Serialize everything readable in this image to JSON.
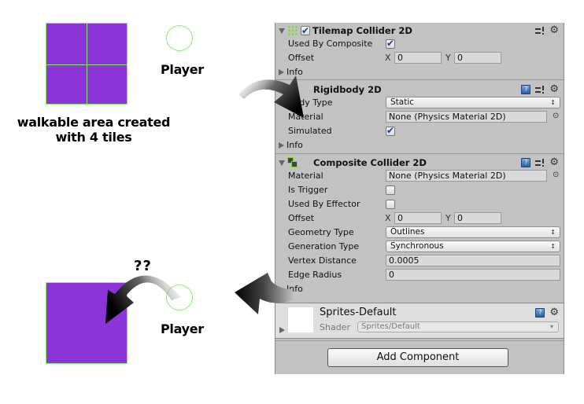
{
  "illustration": {
    "top_caption": "walkable area created with 4 tiles",
    "top_caption_line1": "walkable area created",
    "top_caption_line2": "with 4 tiles",
    "player_label_top": "Player",
    "player_label_bottom": "Player",
    "question_marks": "??",
    "tile_color": "#8b35d9",
    "outline_color": "#86f06a"
  },
  "inspector": {
    "tilemap_collider": {
      "title": "Tilemap Collider 2D",
      "enabled": true,
      "used_by_composite_label": "Used By Composite",
      "used_by_composite": true,
      "offset_label": "Offset",
      "offset_x_label": "X",
      "offset_x": "0",
      "offset_y_label": "Y",
      "offset_y": "0",
      "info_label": "Info"
    },
    "rigidbody": {
      "title": "Rigidbody 2D",
      "body_type_label": "Body Type",
      "body_type": "Static",
      "material_label": "Material",
      "material": "None (Physics Material 2D)",
      "simulated_label": "Simulated",
      "simulated": true,
      "info_label": "Info"
    },
    "composite_collider": {
      "title": "Composite Collider 2D",
      "material_label": "Material",
      "material": "None (Physics Material 2D)",
      "is_trigger_label": "Is Trigger",
      "is_trigger": false,
      "used_by_effector_label": "Used By Effector",
      "used_by_effector": false,
      "offset_label": "Offset",
      "offset_x_label": "X",
      "offset_x": "0",
      "offset_y_label": "Y",
      "offset_y": "0",
      "geometry_type_label": "Geometry Type",
      "geometry_type": "Outlines",
      "generation_type_label": "Generation Type",
      "generation_type": "Synchronous",
      "vertex_distance_label": "Vertex Distance",
      "vertex_distance": "0.0005",
      "edge_radius_label": "Edge Radius",
      "edge_radius": "0",
      "info_label": "Info"
    },
    "material": {
      "name": "Sprites-Default",
      "shader_label": "Shader",
      "shader": "Sprites/Default"
    },
    "add_component_label": "Add Component"
  },
  "icons": {
    "help": "?",
    "gear": "⚙",
    "target": "⊙",
    "dropdown_arrows": "↕",
    "dropdown_down": "▾"
  }
}
